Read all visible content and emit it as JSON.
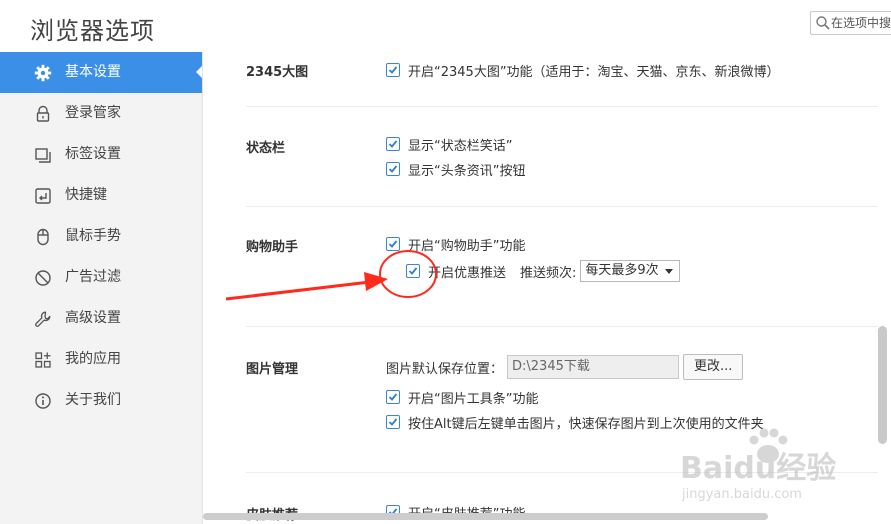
{
  "app": {
    "title": "浏览器选项"
  },
  "search": {
    "placeholder": "在选项中搜索"
  },
  "sidebar": {
    "items": [
      {
        "label": "基本设置",
        "icon": "gear-icon"
      },
      {
        "label": "登录管家",
        "icon": "lock-icon"
      },
      {
        "label": "标签设置",
        "icon": "tabs-icon"
      },
      {
        "label": "快捷键",
        "icon": "keyboard-key-icon"
      },
      {
        "label": "鼠标手势",
        "icon": "mouse-icon"
      },
      {
        "label": "广告过滤",
        "icon": "block-icon"
      },
      {
        "label": "高级设置",
        "icon": "wrench-icon"
      },
      {
        "label": "我的应用",
        "icon": "apps-grid-icon"
      },
      {
        "label": "关于我们",
        "icon": "info-icon"
      }
    ]
  },
  "sections": {
    "bigmap": {
      "title": "2345大图",
      "option": "开启“2345大图”功能（适用于：淘宝、天猫、京东、新浪微博）",
      "checked": true
    },
    "statusbar": {
      "title": "状态栏",
      "options": [
        {
          "label": "显示“状态栏笑话”",
          "checked": true
        },
        {
          "label": "显示“头条资讯”按钮",
          "checked": true
        }
      ]
    },
    "shopping": {
      "title": "购物助手",
      "option": "开启“购物助手”功能",
      "option_checked": true,
      "push_label": "开启优惠推送",
      "push_checked": true,
      "freq_label": "推送频次:",
      "freq_value": "每天最多9次"
    },
    "images": {
      "title": "图片管理",
      "path_label": "图片默认保存位置：",
      "path_value": "D:\\2345下载",
      "change_button": "更改...",
      "options": [
        {
          "label": "开启“图片工具条”功能",
          "checked": true
        },
        {
          "label": "按住Alt键后左键单击图片，快速保存图片到上次使用的文件夹",
          "checked": true
        }
      ]
    },
    "skin": {
      "title": "皮肤推荐",
      "option": "开启“皮肤推荐”功能",
      "checked": true
    }
  },
  "watermark": {
    "line1": "Baidu经验",
    "line2": "jingyan.baidu.com"
  },
  "colors": {
    "accent": "#3b8fe6",
    "checkbox": "#3a85d5",
    "annotation": "#ff2a1a"
  }
}
